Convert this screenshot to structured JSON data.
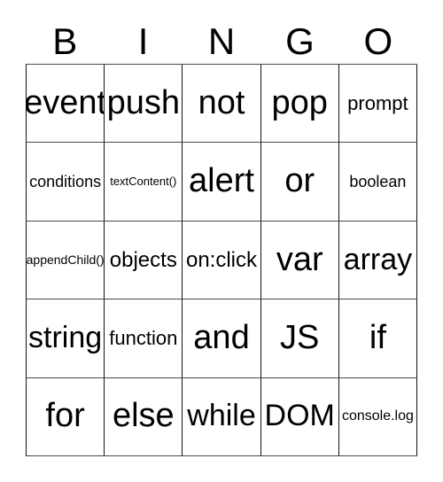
{
  "card": {
    "title": "BINGO",
    "header_letters": [
      "B",
      "I",
      "N",
      "G",
      "O"
    ],
    "columns": 5,
    "rows": 5,
    "colors": {
      "background": "#ffffff",
      "text": "#000000",
      "grid_line": "#111111",
      "grid_line_light": "#4a4a4a"
    },
    "cells": [
      [
        {
          "text": "event",
          "size": "fs-xxl"
        },
        {
          "text": "push",
          "size": "fs-xxl"
        },
        {
          "text": "not",
          "size": "fs-xxl"
        },
        {
          "text": "pop",
          "size": "fs-xxl"
        },
        {
          "text": "prompt",
          "size": "fs-s"
        }
      ],
      [
        {
          "text": "conditions",
          "size": "fs-xs"
        },
        {
          "text": "textContent()",
          "size": "fs-4xs"
        },
        {
          "text": "alert",
          "size": "fs-xxl"
        },
        {
          "text": "or",
          "size": "fs-xxl"
        },
        {
          "text": "boolean",
          "size": "fs-xs"
        }
      ],
      [
        {
          "text": "appendChild()",
          "size": "fs-3xs"
        },
        {
          "text": "objects",
          "size": "fs-m"
        },
        {
          "text": "on:click",
          "size": "fs-m"
        },
        {
          "text": "var",
          "size": "fs-xxl"
        },
        {
          "text": "array",
          "size": "fs-xl"
        }
      ],
      [
        {
          "text": "string",
          "size": "fs-xl"
        },
        {
          "text": "function",
          "size": "fs-s"
        },
        {
          "text": "and",
          "size": "fs-xxl"
        },
        {
          "text": "JS",
          "size": "fs-xxl"
        },
        {
          "text": "if",
          "size": "fs-xxl"
        }
      ],
      [
        {
          "text": "for",
          "size": "fs-xxl"
        },
        {
          "text": "else",
          "size": "fs-xxl"
        },
        {
          "text": "while",
          "size": "fs-xl"
        },
        {
          "text": "DOM",
          "size": "fs-xl"
        },
        {
          "text": "console.log",
          "size": "fs-xxs"
        }
      ]
    ]
  }
}
